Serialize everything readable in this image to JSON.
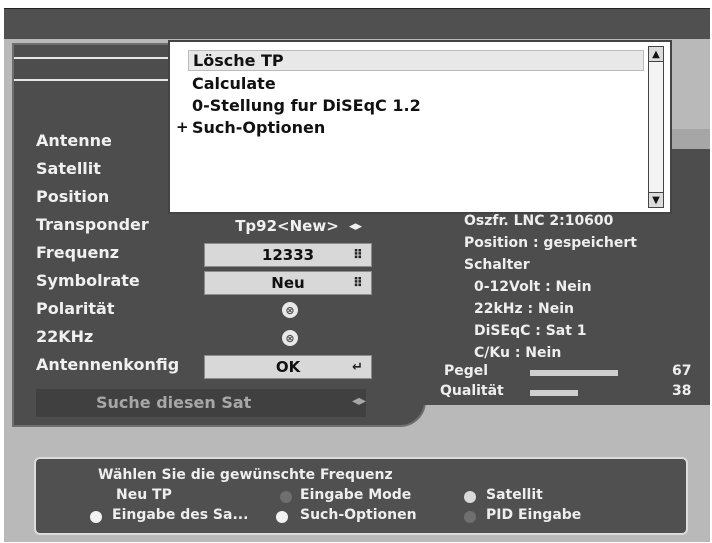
{
  "menu": {
    "items": [
      "Lösche TP",
      "Calculate",
      "0-Stellung fur DiSEqC 1.2",
      "Such-Optionen"
    ],
    "submenu_marker": "+",
    "scroll_up": "▲",
    "scroll_down": "▼"
  },
  "form": {
    "labels": [
      "Antenne",
      "Satellit",
      "Position",
      "Transponder",
      "Frequenz",
      "Symbolrate",
      "Polarität",
      "22KHz",
      "Antennenkonfig"
    ],
    "transponder_value": "Tp92<New>",
    "frequenz_value": "12333",
    "symbolrate_value": "Neu",
    "polaritaet_icon": "⊗",
    "khz_icon": "⊗",
    "antennenkonfig_value": "OK",
    "search_label": "Suche diesen Sat",
    "arrows": "◂▸",
    "keypad_icon": "⠿",
    "enter_icon": "↵"
  },
  "info": {
    "oszfr": "Oszfr. LNC 2:10600",
    "position": "Position : gespeichert",
    "schalter": "Schalter",
    "volt": "0-12Volt : Nein",
    "khz": "22kHz : Nein",
    "diseqc": "DiSEqC : Sat 1",
    "cku": "C/Ku : Nein",
    "pegel_label": "Pegel",
    "pegel_value": "67",
    "qualitaet_label": "Qualität",
    "qualitaet_value": "38"
  },
  "help": {
    "hint": "Wählen Sie die gewünschte Frequenz",
    "options": [
      {
        "label": "Neu TP",
        "color": "#505050"
      },
      {
        "label": "Eingabe Mode",
        "color": "#6f6f6f"
      },
      {
        "label": "Satellit",
        "color": "#d9d9d9"
      },
      {
        "label": "Eingabe des Sa...",
        "color": "#f2f2f2"
      },
      {
        "label": "Such-Optionen",
        "color": "#f2f2f2"
      },
      {
        "label": "PID Eingabe",
        "color": "#6f6f6f"
      }
    ]
  }
}
